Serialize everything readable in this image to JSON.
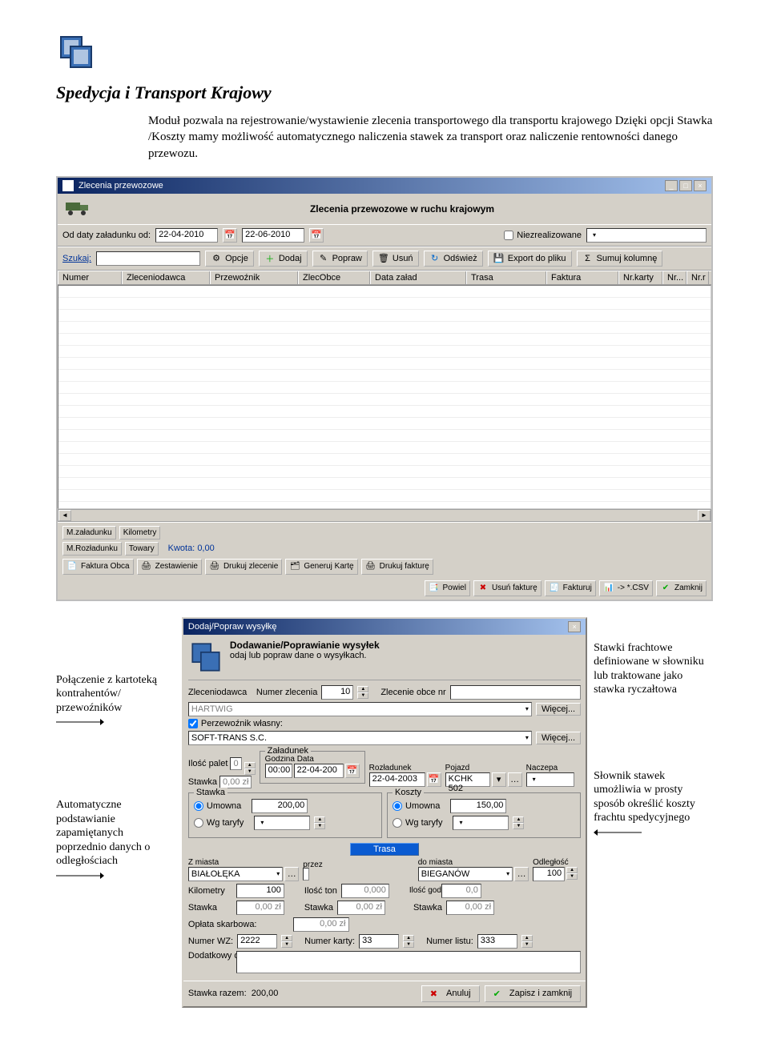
{
  "doc": {
    "heading": "Spedycja i Transport Krajowy",
    "intro": "Moduł pozwala na rejestrowanie/wystawienie zlecenia transportowego dla transportu krajowego Dzięki opcji Stawka /Koszty mamy możliwość automatycznego naliczenia stawek za transport oraz naliczenie rentowności danego przewozu."
  },
  "window": {
    "title": "Zlecenia przewozowe",
    "header": "Zlecenia przewozowe w ruchu krajowym",
    "filter": {
      "label_od": "Od daty załadunku od:",
      "date_from": "22-04-2010",
      "date_to": "22-06-2010",
      "niezrealizowane": "Niezrealizowane"
    },
    "search_label": "Szukaj:",
    "toolbar": {
      "opcje": "Opcje",
      "dodaj": "Dodaj",
      "popraw": "Popraw",
      "usun": "Usuń",
      "odswiez": "Odśwież",
      "export": "Export do pliku",
      "sumuj": "Sumuj kolumnę"
    },
    "columns": {
      "numer": "Numer",
      "zleceniodawca": "Zleceniodawca",
      "przewoznik": "Przewoźnik",
      "zlecobce": "ZlecObce",
      "data_zalad": "Data załad",
      "trasa": "Trasa",
      "faktura": "Faktura",
      "nrkarty": "Nr.karty",
      "nr1": "Nr...",
      "nr2": "Nr.r"
    },
    "bottom": {
      "m_zaladunku": "M.załadunku",
      "kilometry": "Kilometry",
      "m_rozladunku": "M.Rozładunku",
      "towary": "Towary",
      "kwota_label": "Kwota:",
      "kwota_value": "0,00",
      "faktura_obca": "Faktura Obca",
      "zestawienie": "Zestawienie",
      "drukuj_zlecenie": "Drukuj zlecenie",
      "generuj_karte": "Generuj Kartę",
      "drukuj_fakture": "Drukuj fakturę",
      "powiel": "Powiel",
      "usun_fakture": "Usuń fakturę",
      "fakturuj": "Fakturuj",
      "csv": "-> *.CSV",
      "zamknij": "Zamknij"
    }
  },
  "anno": {
    "left1": "Połączenie z kartoteką kontrahentów/ przewoźników",
    "left2": "Automatyczne podstawianie zapamiętanych poprzednio danych o odległościach",
    "right1": "Stawki frachtowe definiowane w słowniku lub traktowane jako stawka ryczałtowa",
    "right2": "Słownik stawek umożliwia w prosty sposób określić koszty frachtu spedycyjnego"
  },
  "dialog": {
    "title": "Dodaj/Popraw wysyłkę",
    "head1": "Dodawanie/Poprawianie wysyłek",
    "head2": "odaj lub popraw dane o wysyłkach.",
    "labels": {
      "zleceniodawca": "Zleceniodawca",
      "numer_zlecenia": "Numer zlecenia",
      "zlecenie_obce": "Zlecenie obce nr",
      "wiecej": "Więcej...",
      "przewoznik_wlasny": "Perzewoźnik własny:",
      "ilosc_palet": "Ilość palet",
      "stawka": "Stawka",
      "zaladunek": "Załadunek",
      "godzina": "Godzina",
      "data": "Data",
      "rozladunek": "Rozładunek",
      "pojazd": "Pojazd",
      "naczepa": "Naczepa",
      "grp_stawka": "Stawka",
      "grp_koszty": "Koszty",
      "umowna": "Umowna",
      "wg_taryfy": "Wg taryfy",
      "trasa": "Trasa",
      "z_miasta": "Z miasta",
      "przez": "przez",
      "do_miasta": "do miasta",
      "odleglosc": "Odległość",
      "kilometry": "Kilometry",
      "ilosc_ton": "Ilość ton",
      "ilosc_godzin": "Ilość godzin",
      "oplata_skarbowa": "Opłata skarbowa:",
      "numer_wz": "Numer WZ:",
      "numer_karty": "Numer karty:",
      "numer_listu": "Numer listu:",
      "dodatkowy_opis": "Dodatkowy opis:",
      "stawka_razem": "Stawka razem:",
      "anuluj": "Anuluj",
      "zapisz": "Zapisz i zamknij"
    },
    "values": {
      "numer_zlecenia": "10",
      "zleceniodawca": "HARTWIG",
      "przewoznik": "SOFT-TRANS S.C.",
      "ilosc_palet": "0",
      "stawka_zl": "0,00 zł",
      "godzina": "00:00",
      "data_zal": "22-04-200",
      "data_roz": "22-04-2003",
      "pojazd": "KCHK 502",
      "umowna_val": "200,00",
      "koszty_umowna": "150,00",
      "z_miasta": "BIAŁOŁĘKA",
      "do_miasta": "BIEGANÓW",
      "odleglosc": "100",
      "kilometry": "100",
      "ilosc_ton": "0,000",
      "ilosc_godzin": "0,0",
      "stawka1": "0,00 zł",
      "stawka2": "0,00 zł",
      "stawka3": "0,00 zł",
      "oplata": "0,00 zł",
      "wz": "2222",
      "karty": "33",
      "listu": "333",
      "razem": "200,00"
    }
  }
}
